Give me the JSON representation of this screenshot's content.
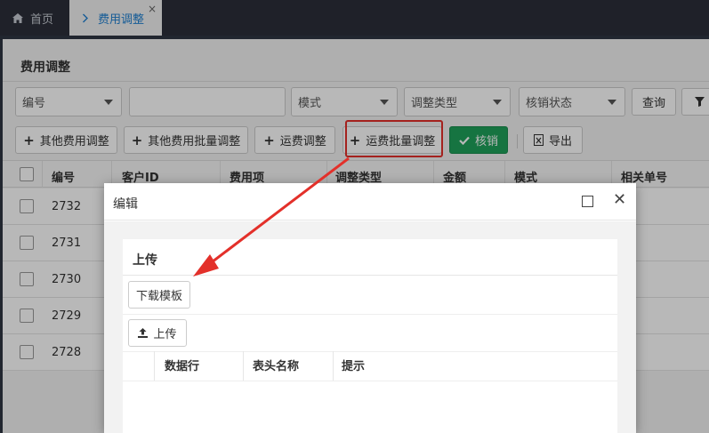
{
  "tabbar": {
    "home_label": "首页",
    "home_icon": "home-icon",
    "active_tab_label": "费用调整",
    "active_tab_chevron": "chevron-right-icon",
    "close_glyph": "×"
  },
  "page": {
    "title": "费用调整"
  },
  "filters": {
    "number_select": "编号",
    "search_input_value": "",
    "mode_select": "模式",
    "adjust_type_select": "调整类型",
    "writeoff_status_select": "核销状态",
    "query_button": "查询",
    "filter_icon": "filter-icon"
  },
  "toolbar": {
    "other_fee_adjust": "其他费用调整",
    "other_fee_batch_adjust": "其他费用批量调整",
    "freight_adjust": "运费调整",
    "freight_batch_adjust": "运费批量调整",
    "writeoff": "核销",
    "export": "导出"
  },
  "table": {
    "columns": [
      "编号",
      "客户ID",
      "费用项",
      "调整类型",
      "金额",
      "模式",
      "相关单号"
    ],
    "rows": [
      {
        "id": "2732"
      },
      {
        "id": "2731"
      },
      {
        "id": "2730"
      },
      {
        "id": "2729"
      },
      {
        "id": "2728"
      }
    ]
  },
  "modal": {
    "title": "编辑",
    "card_title": "上传",
    "download_template": "下载模板",
    "upload": "上传",
    "columns": [
      "数据行",
      "表头名称",
      "提示"
    ]
  },
  "colors": {
    "accent_blue": "#1e7fd0",
    "green": "#1fa15a",
    "highlight_red": "#e3302a",
    "topbar": "#2b2f3a"
  }
}
